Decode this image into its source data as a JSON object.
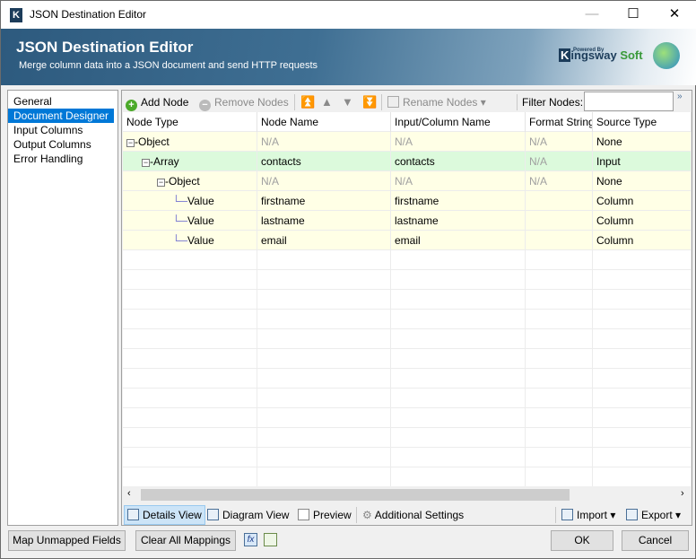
{
  "window": {
    "title": "JSON Destination Editor",
    "minimize": "—",
    "maximize": "☐",
    "close": "✕"
  },
  "banner": {
    "title": "JSON Destination Editor",
    "subtitle": "Merge column data into a JSON document and send HTTP requests",
    "powered_by": "Powered By",
    "brand_k": "K",
    "brand_rest": "ingsway",
    "brand_soft": "Soft"
  },
  "nav": {
    "items": [
      {
        "label": "General"
      },
      {
        "label": "Document Designer",
        "selected": true
      },
      {
        "label": "Input Columns"
      },
      {
        "label": "Output Columns"
      },
      {
        "label": "Error Handling"
      }
    ]
  },
  "toolbar": {
    "add_node": "Add Node",
    "remove_nodes": "Remove Nodes",
    "rename_nodes": "Rename Nodes",
    "filter_label": "Filter Nodes:",
    "filter_value": "",
    "overflow": "»"
  },
  "grid": {
    "columns": [
      "Node Type",
      "Node Name",
      "Input/Column Name",
      "Format String",
      "Source Type"
    ],
    "rows": [
      {
        "type": "Object",
        "name": "N/A",
        "input": "N/A",
        "format": "N/A",
        "source": "None",
        "level": 0
      },
      {
        "type": "Array",
        "name": "contacts",
        "input": "contacts",
        "format": "N/A",
        "source": "Input",
        "level": 1,
        "selected": true
      },
      {
        "type": "Object",
        "name": "N/A",
        "input": "N/A",
        "format": "N/A",
        "source": "None",
        "level": 2
      },
      {
        "type": "Value",
        "name": "firstname",
        "input": "firstname",
        "format": "",
        "source": "Column",
        "level": 3
      },
      {
        "type": "Value",
        "name": "lastname",
        "input": "lastname",
        "format": "",
        "source": "Column",
        "level": 3
      },
      {
        "type": "Value",
        "name": "email",
        "input": "email",
        "format": "",
        "source": "Column",
        "level": 3
      }
    ]
  },
  "bottom_toolbar": {
    "details_view": "Details View",
    "diagram_view": "Diagram View",
    "preview": "Preview",
    "additional_settings": "Additional Settings",
    "import": "Import",
    "export": "Export"
  },
  "footer": {
    "map_unmapped": "Map Unmapped Fields",
    "clear_all": "Clear All Mappings",
    "ok": "OK",
    "cancel": "Cancel"
  },
  "colors": {
    "row_bg": "#ffffe6",
    "selected_row_bg": "#dcfadc",
    "accent": "#0078d7"
  }
}
